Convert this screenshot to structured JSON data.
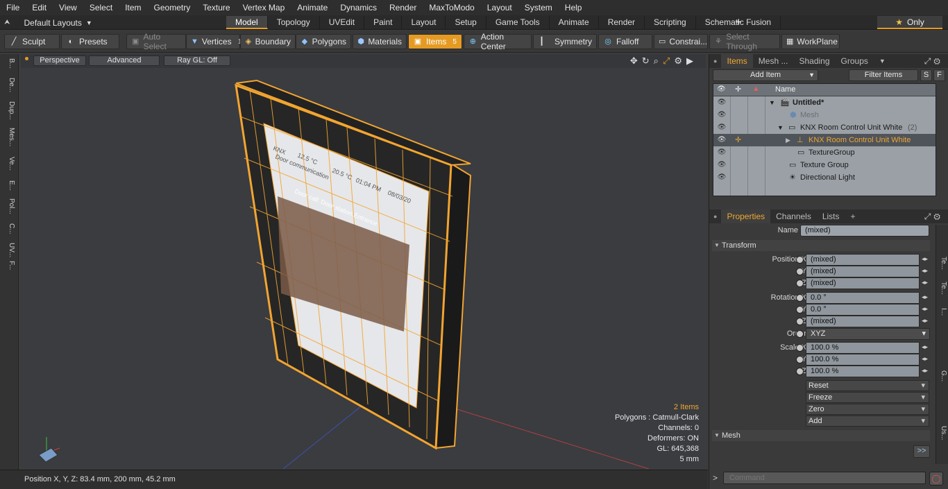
{
  "menu": [
    "File",
    "Edit",
    "View",
    "Select",
    "Item",
    "Geometry",
    "Texture",
    "Vertex Map",
    "Animate",
    "Dynamics",
    "Render",
    "MaxToModo",
    "Layout",
    "System",
    "Help"
  ],
  "layout": {
    "default_layouts": "Default Layouts",
    "tabs": [
      "Model",
      "Topology",
      "UVEdit",
      "Paint",
      "Layout",
      "Setup",
      "Game Tools",
      "Animate",
      "Render",
      "Scripting",
      "Schematic Fusion"
    ],
    "active_tab": "Model",
    "plus": "+",
    "only": "Only"
  },
  "toolbar": {
    "sculpt": "Sculpt",
    "presets": "Presets",
    "auto_select": "Auto Select",
    "vertices": "Vertices",
    "vertices_count": "1",
    "boundary": "Boundary",
    "polygons": "Polygons",
    "materials": "Materials",
    "items": "Items",
    "items_count": "5",
    "action_center": "Action Center",
    "symmetry": "Symmetry",
    "falloff": "Falloff",
    "constraints": "Constrai...",
    "select_through": "Select Through",
    "workplane": "WorkPlane"
  },
  "left_tabs": [
    "B...",
    "De...",
    "Dup...",
    "Mes...",
    "Ve...",
    "E...",
    "Pol...",
    "C...",
    "UV...",
    "F..."
  ],
  "viewport": {
    "view": "Perspective",
    "shading": "Advanced",
    "raygl": "Ray GL: Off",
    "stats": {
      "items": "2 Items",
      "polygons": "Polygons : Catmull-Clark",
      "channels": "Channels: 0",
      "deformers": "Deformers: ON",
      "gl": "GL: 645,368",
      "unit": "5 mm"
    },
    "screen": {
      "brand": "KNX",
      "temp1": "12.5 °C",
      "temp2": "20.5 °C",
      "time": "01:04 PM",
      "date": "08/03/20",
      "title": "Door communication",
      "call": "Door call: Door station Entrance"
    }
  },
  "status": {
    "position": "Position X, Y, Z:  83.4 mm, 200 mm, 45.2 mm"
  },
  "items_panel": {
    "tabs": [
      "Items",
      "Mesh ...",
      "Shading",
      "Groups"
    ],
    "add_item": "Add Item",
    "filter": "Filter Items",
    "s": "S",
    "f": "F",
    "name_col": "Name",
    "rows": [
      {
        "name": "Untitled*"
      },
      {
        "name": "Mesh"
      },
      {
        "name": "KNX Room Control Unit White",
        "suffix": "(2)"
      },
      {
        "name": "KNX Room Control Unit White"
      },
      {
        "name": "TextureGroup"
      },
      {
        "name": "Texture Group"
      },
      {
        "name": "Directional Light"
      }
    ]
  },
  "properties": {
    "tabs": [
      "Properties",
      "Channels",
      "Lists"
    ],
    "plus": "+",
    "name_label": "Name",
    "name_value": "(mixed)",
    "transform": "Transform",
    "position": {
      "label": "Position X",
      "y": "Y",
      "z": "Z",
      "x_val": "(mixed)",
      "y_val": "(mixed)",
      "z_val": "(mixed)"
    },
    "rotation": {
      "label": "Rotation X",
      "y": "Y",
      "z": "Z",
      "x_val": "0.0 °",
      "y_val": "0.0 °",
      "z_val": "(mixed)"
    },
    "order": {
      "label": "Order",
      "value": "XYZ"
    },
    "scale": {
      "label": "Scale X",
      "y": "Y",
      "z": "Z",
      "x_val": "100.0 %",
      "y_val": "100.0 %",
      "z_val": "100.0 %"
    },
    "buttons": [
      "Reset",
      "Freeze",
      "Zero",
      "Add"
    ],
    "mesh": "Mesh",
    "more": ">>"
  },
  "right_strip": [
    "Te...",
    "Te...",
    "I...",
    "G...",
    "Us..."
  ],
  "command": {
    "prompt": ">",
    "placeholder": "Command"
  }
}
